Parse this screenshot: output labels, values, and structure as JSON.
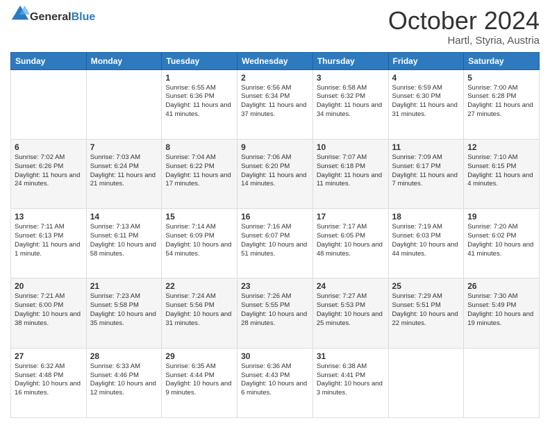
{
  "header": {
    "logo_line1": "General",
    "logo_line2": "Blue",
    "month_title": "October 2024",
    "subtitle": "Hartl, Styria, Austria"
  },
  "weekdays": [
    "Sunday",
    "Monday",
    "Tuesday",
    "Wednesday",
    "Thursday",
    "Friday",
    "Saturday"
  ],
  "weeks": [
    [
      {
        "day": "",
        "sunrise": "",
        "sunset": "",
        "daylight": ""
      },
      {
        "day": "",
        "sunrise": "",
        "sunset": "",
        "daylight": ""
      },
      {
        "day": "1",
        "sunrise": "Sunrise: 6:55 AM",
        "sunset": "Sunset: 6:36 PM",
        "daylight": "Daylight: 11 hours and 41 minutes."
      },
      {
        "day": "2",
        "sunrise": "Sunrise: 6:56 AM",
        "sunset": "Sunset: 6:34 PM",
        "daylight": "Daylight: 11 hours and 37 minutes."
      },
      {
        "day": "3",
        "sunrise": "Sunrise: 6:58 AM",
        "sunset": "Sunset: 6:32 PM",
        "daylight": "Daylight: 11 hours and 34 minutes."
      },
      {
        "day": "4",
        "sunrise": "Sunrise: 6:59 AM",
        "sunset": "Sunset: 6:30 PM",
        "daylight": "Daylight: 11 hours and 31 minutes."
      },
      {
        "day": "5",
        "sunrise": "Sunrise: 7:00 AM",
        "sunset": "Sunset: 6:28 PM",
        "daylight": "Daylight: 11 hours and 27 minutes."
      }
    ],
    [
      {
        "day": "6",
        "sunrise": "Sunrise: 7:02 AM",
        "sunset": "Sunset: 6:26 PM",
        "daylight": "Daylight: 11 hours and 24 minutes."
      },
      {
        "day": "7",
        "sunrise": "Sunrise: 7:03 AM",
        "sunset": "Sunset: 6:24 PM",
        "daylight": "Daylight: 11 hours and 21 minutes."
      },
      {
        "day": "8",
        "sunrise": "Sunrise: 7:04 AM",
        "sunset": "Sunset: 6:22 PM",
        "daylight": "Daylight: 11 hours and 17 minutes."
      },
      {
        "day": "9",
        "sunrise": "Sunrise: 7:06 AM",
        "sunset": "Sunset: 6:20 PM",
        "daylight": "Daylight: 11 hours and 14 minutes."
      },
      {
        "day": "10",
        "sunrise": "Sunrise: 7:07 AM",
        "sunset": "Sunset: 6:18 PM",
        "daylight": "Daylight: 11 hours and 11 minutes."
      },
      {
        "day": "11",
        "sunrise": "Sunrise: 7:09 AM",
        "sunset": "Sunset: 6:17 PM",
        "daylight": "Daylight: 11 hours and 7 minutes."
      },
      {
        "day": "12",
        "sunrise": "Sunrise: 7:10 AM",
        "sunset": "Sunset: 6:15 PM",
        "daylight": "Daylight: 11 hours and 4 minutes."
      }
    ],
    [
      {
        "day": "13",
        "sunrise": "Sunrise: 7:11 AM",
        "sunset": "Sunset: 6:13 PM",
        "daylight": "Daylight: 11 hours and 1 minute."
      },
      {
        "day": "14",
        "sunrise": "Sunrise: 7:13 AM",
        "sunset": "Sunset: 6:11 PM",
        "daylight": "Daylight: 10 hours and 58 minutes."
      },
      {
        "day": "15",
        "sunrise": "Sunrise: 7:14 AM",
        "sunset": "Sunset: 6:09 PM",
        "daylight": "Daylight: 10 hours and 54 minutes."
      },
      {
        "day": "16",
        "sunrise": "Sunrise: 7:16 AM",
        "sunset": "Sunset: 6:07 PM",
        "daylight": "Daylight: 10 hours and 51 minutes."
      },
      {
        "day": "17",
        "sunrise": "Sunrise: 7:17 AM",
        "sunset": "Sunset: 6:05 PM",
        "daylight": "Daylight: 10 hours and 48 minutes."
      },
      {
        "day": "18",
        "sunrise": "Sunrise: 7:19 AM",
        "sunset": "Sunset: 6:03 PM",
        "daylight": "Daylight: 10 hours and 44 minutes."
      },
      {
        "day": "19",
        "sunrise": "Sunrise: 7:20 AM",
        "sunset": "Sunset: 6:02 PM",
        "daylight": "Daylight: 10 hours and 41 minutes."
      }
    ],
    [
      {
        "day": "20",
        "sunrise": "Sunrise: 7:21 AM",
        "sunset": "Sunset: 6:00 PM",
        "daylight": "Daylight: 10 hours and 38 minutes."
      },
      {
        "day": "21",
        "sunrise": "Sunrise: 7:23 AM",
        "sunset": "Sunset: 5:58 PM",
        "daylight": "Daylight: 10 hours and 35 minutes."
      },
      {
        "day": "22",
        "sunrise": "Sunrise: 7:24 AM",
        "sunset": "Sunset: 5:56 PM",
        "daylight": "Daylight: 10 hours and 31 minutes."
      },
      {
        "day": "23",
        "sunrise": "Sunrise: 7:26 AM",
        "sunset": "Sunset: 5:55 PM",
        "daylight": "Daylight: 10 hours and 28 minutes."
      },
      {
        "day": "24",
        "sunrise": "Sunrise: 7:27 AM",
        "sunset": "Sunset: 5:53 PM",
        "daylight": "Daylight: 10 hours and 25 minutes."
      },
      {
        "day": "25",
        "sunrise": "Sunrise: 7:29 AM",
        "sunset": "Sunset: 5:51 PM",
        "daylight": "Daylight: 10 hours and 22 minutes."
      },
      {
        "day": "26",
        "sunrise": "Sunrise: 7:30 AM",
        "sunset": "Sunset: 5:49 PM",
        "daylight": "Daylight: 10 hours and 19 minutes."
      }
    ],
    [
      {
        "day": "27",
        "sunrise": "Sunrise: 6:32 AM",
        "sunset": "Sunset: 4:48 PM",
        "daylight": "Daylight: 10 hours and 16 minutes."
      },
      {
        "day": "28",
        "sunrise": "Sunrise: 6:33 AM",
        "sunset": "Sunset: 4:46 PM",
        "daylight": "Daylight: 10 hours and 12 minutes."
      },
      {
        "day": "29",
        "sunrise": "Sunrise: 6:35 AM",
        "sunset": "Sunset: 4:44 PM",
        "daylight": "Daylight: 10 hours and 9 minutes."
      },
      {
        "day": "30",
        "sunrise": "Sunrise: 6:36 AM",
        "sunset": "Sunset: 4:43 PM",
        "daylight": "Daylight: 10 hours and 6 minutes."
      },
      {
        "day": "31",
        "sunrise": "Sunrise: 6:38 AM",
        "sunset": "Sunset: 4:41 PM",
        "daylight": "Daylight: 10 hours and 3 minutes."
      },
      {
        "day": "",
        "sunrise": "",
        "sunset": "",
        "daylight": ""
      },
      {
        "day": "",
        "sunrise": "",
        "sunset": "",
        "daylight": ""
      }
    ]
  ]
}
